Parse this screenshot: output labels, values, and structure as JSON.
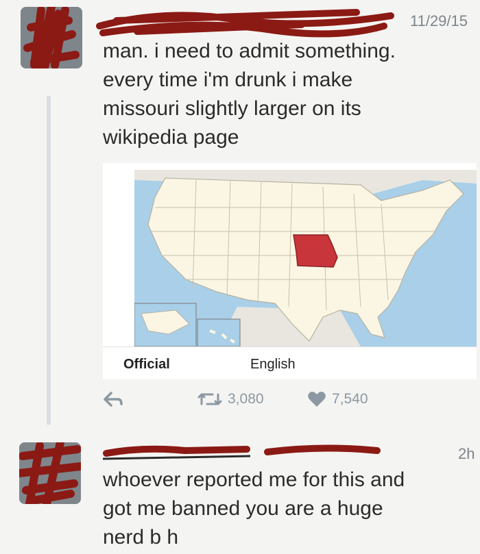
{
  "tweet1": {
    "timestamp": "11/29/15",
    "text": "man. i need to admit something.\nevery time i'm drunk i make\nmissouri slightly larger on its\nwikipedia page",
    "map_tabs": [
      "Official",
      "English"
    ],
    "retweets": "3,080",
    "likes": "7,540"
  },
  "tweet2": {
    "timestamp": "2h",
    "text": "whoever reported me for this and\ngot me banned you are a huge\nnerd b    h"
  },
  "colors": {
    "redaction": "#8b1a14",
    "missouri": "#c8353a",
    "land": "#fbf6e4",
    "water": "#a9cfe9"
  },
  "icons": [
    "reply-icon",
    "retweet-icon",
    "heart-icon"
  ]
}
